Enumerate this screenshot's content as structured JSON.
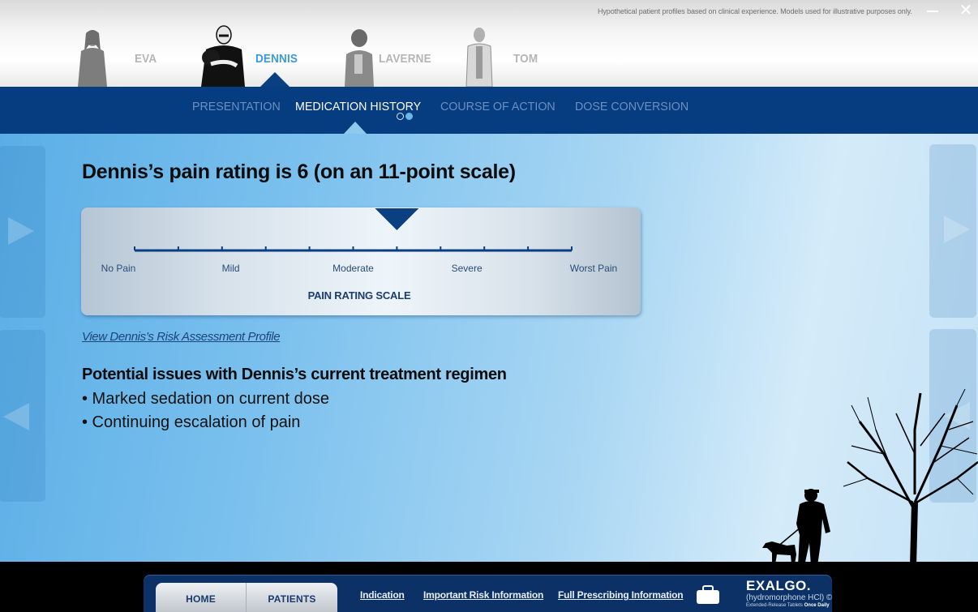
{
  "window": {
    "disclaimer": "Hypothetical patient profiles based on clinical experience. Models used for illustrative purposes only.",
    "minimize_icon": "minimize-icon",
    "close_icon": "close-icon"
  },
  "patients": [
    {
      "name": "EVA",
      "active": false
    },
    {
      "name": "DENNIS",
      "active": true
    },
    {
      "name": "LAVERNE",
      "active": false
    },
    {
      "name": "TOM",
      "active": false
    }
  ],
  "nav": {
    "tabs": [
      {
        "label": "PRESENTATION",
        "active": false
      },
      {
        "label": "MEDICATION HISTORY",
        "active": true
      },
      {
        "label": "COURSE OF ACTION",
        "active": false
      },
      {
        "label": "DOSE CONVERSION",
        "active": false
      }
    ],
    "subpage_dots": {
      "count": 2,
      "current": 2
    }
  },
  "main": {
    "title": "Dennis’s pain rating is 6 (on an 11-point scale)",
    "pain_scale": {
      "title": "PAIN RATING SCALE",
      "min": 0,
      "max": 10,
      "points": 11,
      "current_rating": 6,
      "labels": [
        {
          "text": "No Pain",
          "at": 0
        },
        {
          "text": "Mild",
          "at": 2.2
        },
        {
          "text": "Moderate",
          "at": 5
        },
        {
          "text": "Severe",
          "at": 7.6
        },
        {
          "text": "Worst Pain",
          "at": 10.5
        }
      ]
    },
    "risk_link": "View Dennis’s Risk Assessment Profile",
    "issues_heading": "Potential issues with Dennis’s current treatment regimen",
    "issues": [
      "• Marked sedation on current dose",
      "• Continuing escalation of pain"
    ]
  },
  "footer": {
    "home_label": "HOME",
    "patients_label": "PATIENTS",
    "links": [
      "Indication",
      "Important Risk Information",
      "Full Prescribing Information"
    ],
    "briefcase_icon": "briefcase-icon",
    "brand": {
      "name": "EXALGO.",
      "generic": "(hydromorphone HCl) ©",
      "tagline_a": "Extended-Release Tablets",
      "tagline_b": "Once Daily"
    }
  },
  "colors": {
    "nav_bg": "#063c80",
    "active_patient": "#3a9ad9",
    "inactive_tab": "#6d8fbf",
    "scale_line": "#0a3f82"
  }
}
